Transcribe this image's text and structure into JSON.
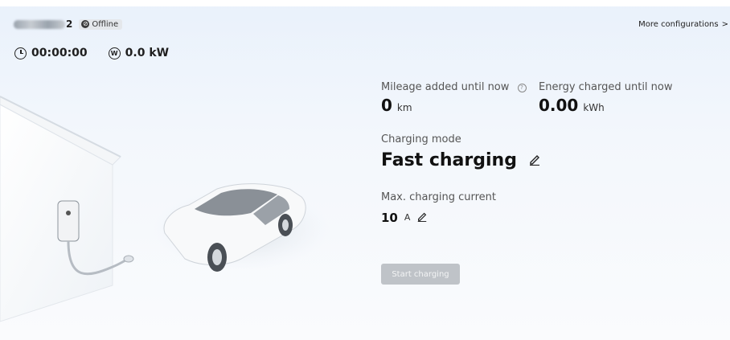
{
  "header": {
    "device_name_suffix": "2",
    "status_label": "Offline",
    "more_config_label": "More configurations",
    "more_config_chevron": ">"
  },
  "stats": {
    "duration": "00:00:00",
    "power": "0.0 kW"
  },
  "metrics": {
    "mileage_label": "Mileage added until now",
    "mileage_value": "0",
    "mileage_unit": "km",
    "energy_label": "Energy charged until now",
    "energy_value": "0.00",
    "energy_unit": "kWh"
  },
  "charging_mode": {
    "label": "Charging mode",
    "value": "Fast charging"
  },
  "max_current": {
    "label": "Max. charging current",
    "value": "10",
    "unit": "A"
  },
  "actions": {
    "start_label": "Start charging"
  },
  "icons": {
    "status": "offline-icon",
    "timer": "clock-icon",
    "power": "power-w-icon",
    "info": "info-icon",
    "edit": "pencil-icon"
  },
  "colors": {
    "background_top": "#e9f1fb",
    "disabled_button": "#bfc3c8"
  }
}
